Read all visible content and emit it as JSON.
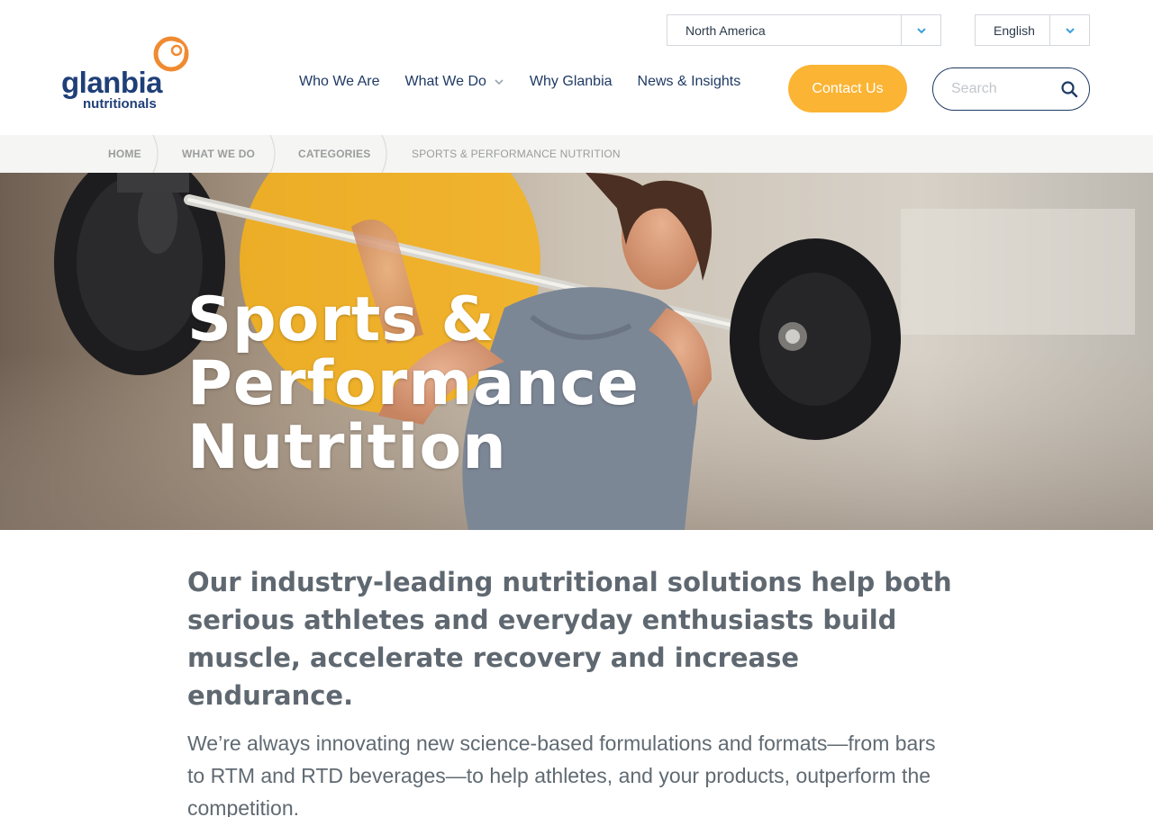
{
  "brand": {
    "name": "glanbia",
    "subname": "nutritionals",
    "colors": {
      "navy": "#1f3f78",
      "orange": "#f08a32",
      "yellow": "#fbb434"
    }
  },
  "region_select": {
    "value": "North America",
    "icon": "chevron-down-icon"
  },
  "language_select": {
    "value": "English",
    "icon": "chevron-down-icon"
  },
  "nav": {
    "items": [
      {
        "label": "Who We Are"
      },
      {
        "label": "What We Do",
        "has_dropdown": true
      },
      {
        "label": "Why Glanbia"
      },
      {
        "label": "News & Insights"
      }
    ]
  },
  "contact_button": {
    "label": "Contact Us"
  },
  "search": {
    "placeholder": "Search",
    "icon": "search-icon"
  },
  "breadcrumb": {
    "items": [
      {
        "label": "HOME"
      },
      {
        "label": "WHAT WE DO"
      },
      {
        "label": "CATEGORIES"
      },
      {
        "label": "SPORTS & PERFORMANCE NUTRITION"
      }
    ]
  },
  "hero": {
    "title_lines": [
      "Sports &",
      "Performance",
      "Nutrition"
    ],
    "accent_color": "#f6b21b"
  },
  "content": {
    "lead": "Our industry-leading nutritional solutions help both serious athletes and everyday enthusiasts build muscle, accelerate recovery and increase endurance.",
    "body": "We’re always innovating new science-based formulations and formats—from bars to RTM and RTD beverages—to help athletes, and your products, outperform the competition."
  }
}
